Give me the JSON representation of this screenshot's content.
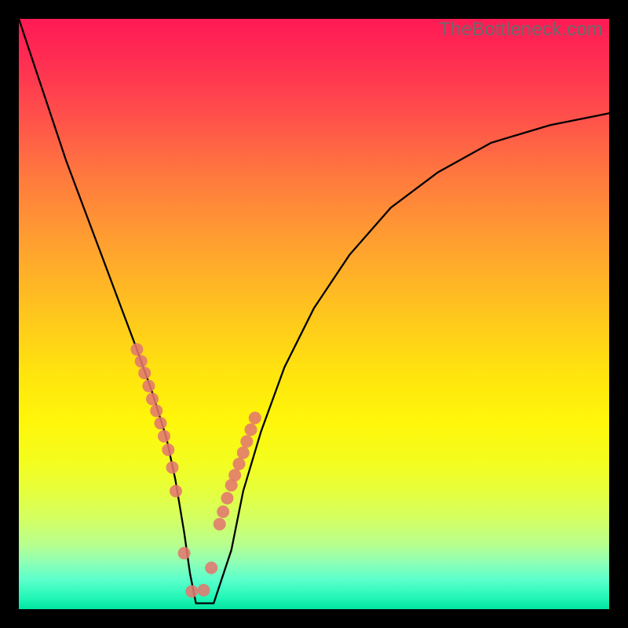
{
  "watermark": "TheBottleneck.com",
  "colors": {
    "frame": "#000000",
    "curve": "#000000",
    "dot": "#e3786e",
    "gradient_top": "#ff1a54",
    "gradient_mid": "#ffe40e",
    "gradient_bottom": "#00e5a0"
  },
  "chart_data": {
    "type": "line",
    "title": "",
    "xlabel": "",
    "ylabel": "",
    "xlim": [
      0,
      100
    ],
    "ylim": [
      0,
      100
    ],
    "note": "Axes are normalized percentages of the plot area; no tick labels are drawn in the image.",
    "series": [
      {
        "name": "bottleneck-curve",
        "x": [
          0,
          2,
          5,
          8,
          11,
          14,
          17,
          20,
          22.5,
          25,
          26.5,
          28,
          29,
          30,
          33,
          36,
          38,
          41,
          45,
          50,
          56,
          63,
          71,
          80,
          90,
          100
        ],
        "y": [
          100,
          94,
          85,
          76,
          68,
          60,
          52,
          44,
          37,
          29,
          22,
          13,
          6,
          1,
          1,
          10,
          20,
          30,
          41,
          51,
          60,
          68,
          74,
          79,
          82,
          84
        ]
      }
    ],
    "scatter_dots": {
      "name": "highlight-dots",
      "x": [
        20.0,
        20.7,
        21.3,
        22.0,
        22.6,
        23.3,
        24.0,
        24.6,
        25.3,
        26.0,
        26.6,
        28.0,
        29.3,
        31.3,
        32.6,
        34.0,
        34.6,
        35.3,
        36.0,
        36.6,
        37.3,
        38.0,
        38.6,
        39.3,
        40.0
      ],
      "y": [
        44.0,
        42.0,
        40.0,
        37.8,
        35.6,
        33.6,
        31.5,
        29.3,
        27.0,
        24.0,
        20.0,
        9.5,
        3.0,
        3.2,
        7.0,
        14.4,
        16.5,
        18.8,
        21.0,
        22.7,
        24.6,
        26.5,
        28.4,
        30.4,
        32.4
      ]
    }
  }
}
